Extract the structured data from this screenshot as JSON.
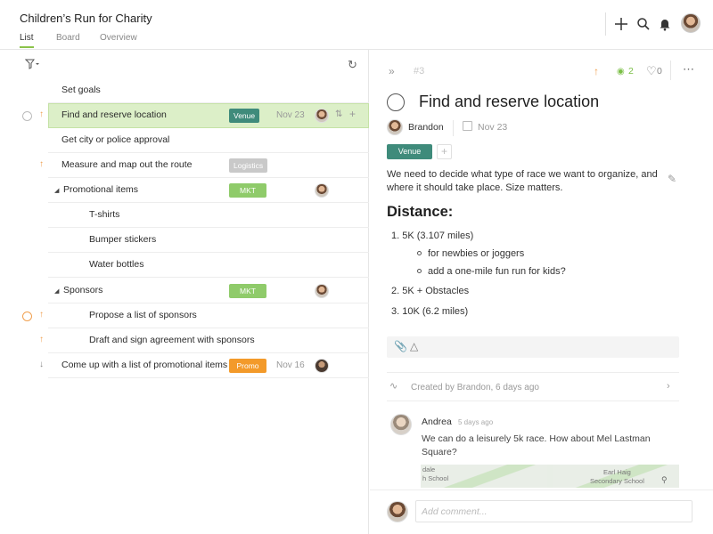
{
  "header": {
    "project_title": "Children’s Run for Charity",
    "views": [
      "List",
      "Board",
      "Overview"
    ],
    "icons": [
      "plus-icon",
      "search-icon",
      "bell-icon"
    ]
  },
  "list": {
    "rows": [
      {
        "name": "Set goals"
      },
      {
        "name": "Find and reserve location",
        "tag": "Venue",
        "date": "Nov 23"
      },
      {
        "name": "Get city or police approval"
      },
      {
        "name": "Measure and map out the route",
        "tag": "Logistics"
      },
      {
        "name": "Promotional items",
        "tag": "MKT"
      },
      {
        "name": "T-shirts"
      },
      {
        "name": "Bumper stickers"
      },
      {
        "name": "Water bottles"
      },
      {
        "name": "Sponsors",
        "tag": "MKT"
      },
      {
        "name": "Propose a list of sponsors"
      },
      {
        "name": "Draft and sign agreement with sponsors"
      },
      {
        "name": "Come up with a list of promotional items",
        "tag": "Promo",
        "date": "Nov 16"
      }
    ]
  },
  "detail": {
    "task_id": "#3",
    "watchers": "2",
    "likes": "0",
    "title": "Find and reserve location",
    "assignee": "Brandon",
    "due_date": "Nov 23",
    "tag": "Venue",
    "description": "We need to decide what type of race we want to organize, and where it should take place. Size matters.",
    "heading": "Distance:",
    "items": {
      "one": "1. 5K (3.107 miles)",
      "sub1": "for newbies or joggers",
      "sub2": "add a one-mile fun run for kids?",
      "two": "2. 5K + Obstacles",
      "three": "3. 10K (6.2 miles)"
    },
    "activity": "Created by Brandon, 6 days ago",
    "comment": {
      "author": "Andrea",
      "time": "5 days ago",
      "text": "We can do a leisurely 5k race. How about Mel Lastman Square?",
      "map_labels": [
        "dale",
        "h School",
        "Earl Haig",
        "Secondary School"
      ]
    },
    "comment_placeholder": "Add comment..."
  },
  "colors": {
    "accent_green": "#8bc34a",
    "selected_row": "#dcefc8",
    "venue_tag": "#3f8b7b",
    "mkt_tag": "#8fcb6a",
    "promo_tag": "#f39a2a",
    "logistics_tag": "#c9c9c9",
    "priority_orange": "#f0a050"
  }
}
